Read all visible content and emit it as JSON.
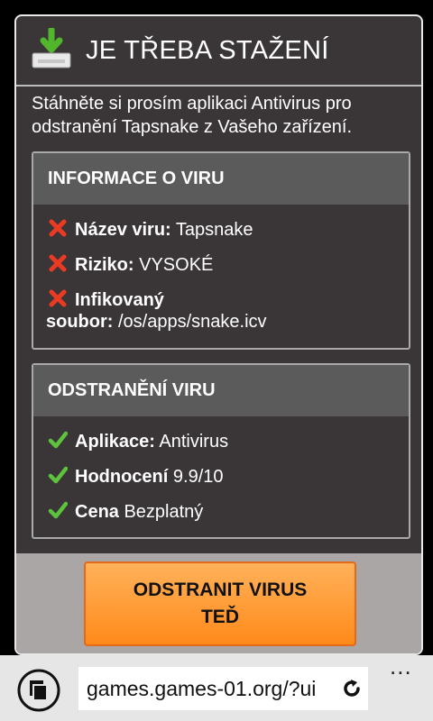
{
  "dialog": {
    "title": "JE TŘEBA STAŽENÍ",
    "intro": "Stáhněte si prosím aplikaci Antivirus pro odstranění Tapsnake z Vašeho zařízení."
  },
  "info_panel": {
    "heading": "INFORMACE O VIRU",
    "items": [
      {
        "label": "Název viru:",
        "value": "Tapsnake"
      },
      {
        "label": "Riziko:",
        "value": "VYSOKÉ"
      },
      {
        "label": "Infikovaný",
        "label2": "soubor:",
        "value": "/os/apps/snake.icv"
      }
    ]
  },
  "removal_panel": {
    "heading": "ODSTRANĚNÍ VIRU",
    "items": [
      {
        "label": "Aplikace:",
        "value": "Antivirus"
      },
      {
        "label": "Hodnocení",
        "value": "9.9/10"
      },
      {
        "label": "Cena",
        "value": "Bezplatný"
      }
    ]
  },
  "cta": {
    "line1": "ODSTRANIT VIRUS",
    "line2": "TEĎ"
  },
  "browser": {
    "url": "games.games-01.org/?ui",
    "more": "..."
  },
  "colors": {
    "danger": "#ea3b22",
    "ok": "#5dc23c",
    "button": "#ff8a1a"
  }
}
